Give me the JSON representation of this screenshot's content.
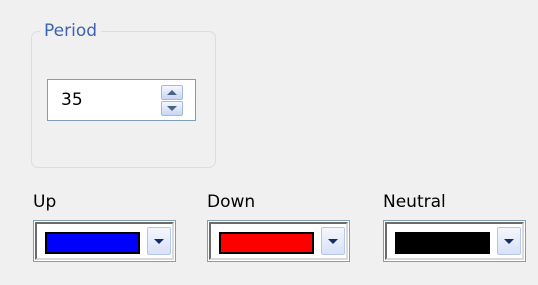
{
  "period_group": {
    "legend": "Period",
    "spinner": {
      "value": "35"
    }
  },
  "colors": [
    {
      "label": "Up",
      "swatch_color": "#0000ff"
    },
    {
      "label": "Down",
      "swatch_color": "#ff0000"
    },
    {
      "label": "Neutral",
      "swatch_color": "#000000"
    }
  ],
  "theme": {
    "legend_color": "#3d63b5",
    "panel_background": "#f0f0f0",
    "field_border": "#7f9db9"
  },
  "icons": {
    "spin_up": "triangle-up-icon",
    "spin_down": "triangle-down-icon",
    "dropdown": "chevron-down-icon"
  }
}
